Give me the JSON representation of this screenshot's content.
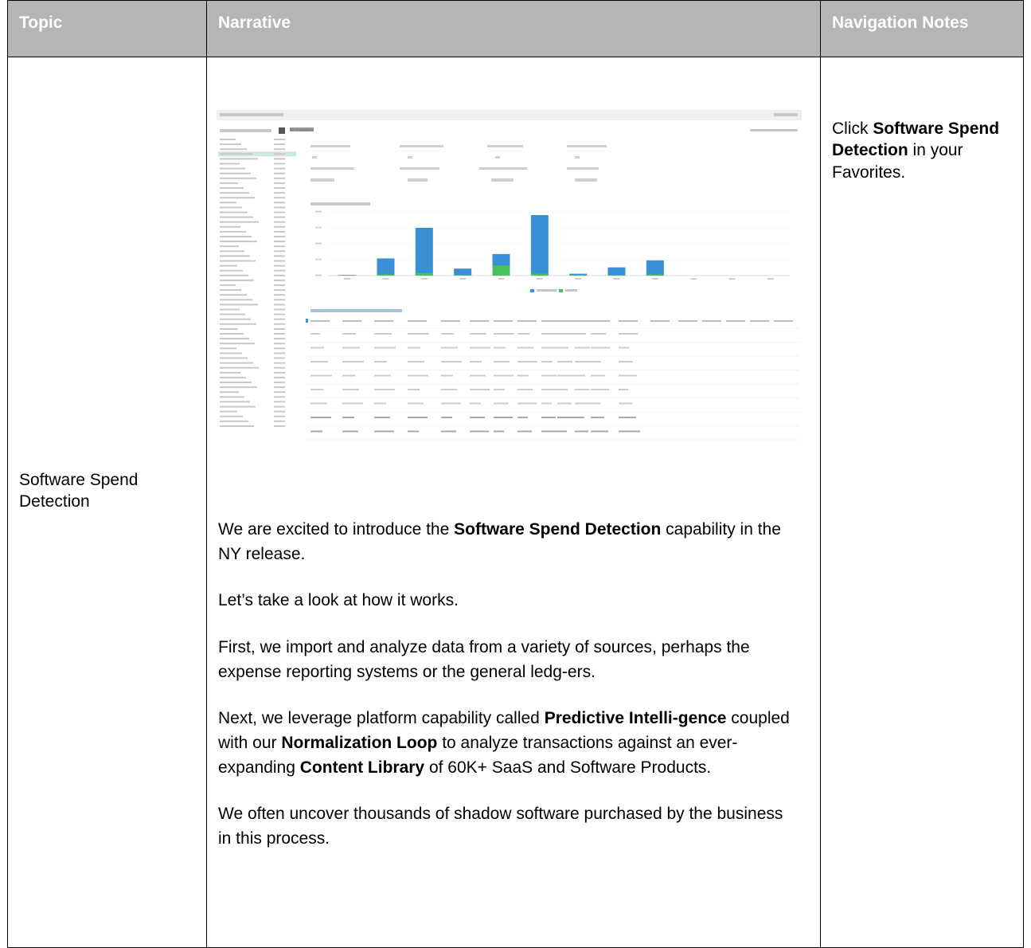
{
  "header": {
    "topic": "Topic",
    "narrative": "Narrative",
    "navigation": "Navigation Notes"
  },
  "row": {
    "topic": "Software Spend Detection",
    "navigation": {
      "pre": "Click ",
      "bold": "Software Spend Detection",
      "post": " in your Favorites."
    },
    "narrative": {
      "p1": {
        "pre": "We are excited to introduce the ",
        "bold": "Software Spend Detection",
        "post": " capability in the NY release."
      },
      "p2": "Let’s take a look at how it works.",
      "p3": "First, we import and analyze data from a variety of sources, perhaps the expense reporting systems or the general ledg-ers.",
      "p4": {
        "a": "Next, we leverage platform capability called ",
        "b1": "Predictive Intelli-gence",
        "c": " coupled with our ",
        "b2": "Normalization Loop",
        "d": " to analyze transactions against an ever-expanding ",
        "b3": "Content Library",
        "e": " of 60K+ SaaS and Software Products."
      },
      "p5": "We often uncover thousands of shadow software purchased by the business in this process."
    }
  },
  "screenshot": {
    "section_title": "All Publishers",
    "chart_colors": {
      "primary": "#3a8fd6",
      "secondary": "#45c35a"
    }
  },
  "chart_data": {
    "type": "bar",
    "categories": [
      "1",
      "2",
      "3",
      "4",
      "5",
      "6",
      "7",
      "8",
      "9",
      "10",
      "11",
      "12"
    ],
    "series": [
      {
        "values": [
          1,
          27,
          75,
          11,
          34,
          95,
          3,
          13,
          24,
          0,
          0,
          0
        ]
      },
      {
        "values": [
          1,
          2,
          4,
          1,
          16,
          3,
          1,
          1,
          2,
          0,
          0,
          0
        ]
      }
    ],
    "ylim": [
      0,
      100
    ]
  }
}
